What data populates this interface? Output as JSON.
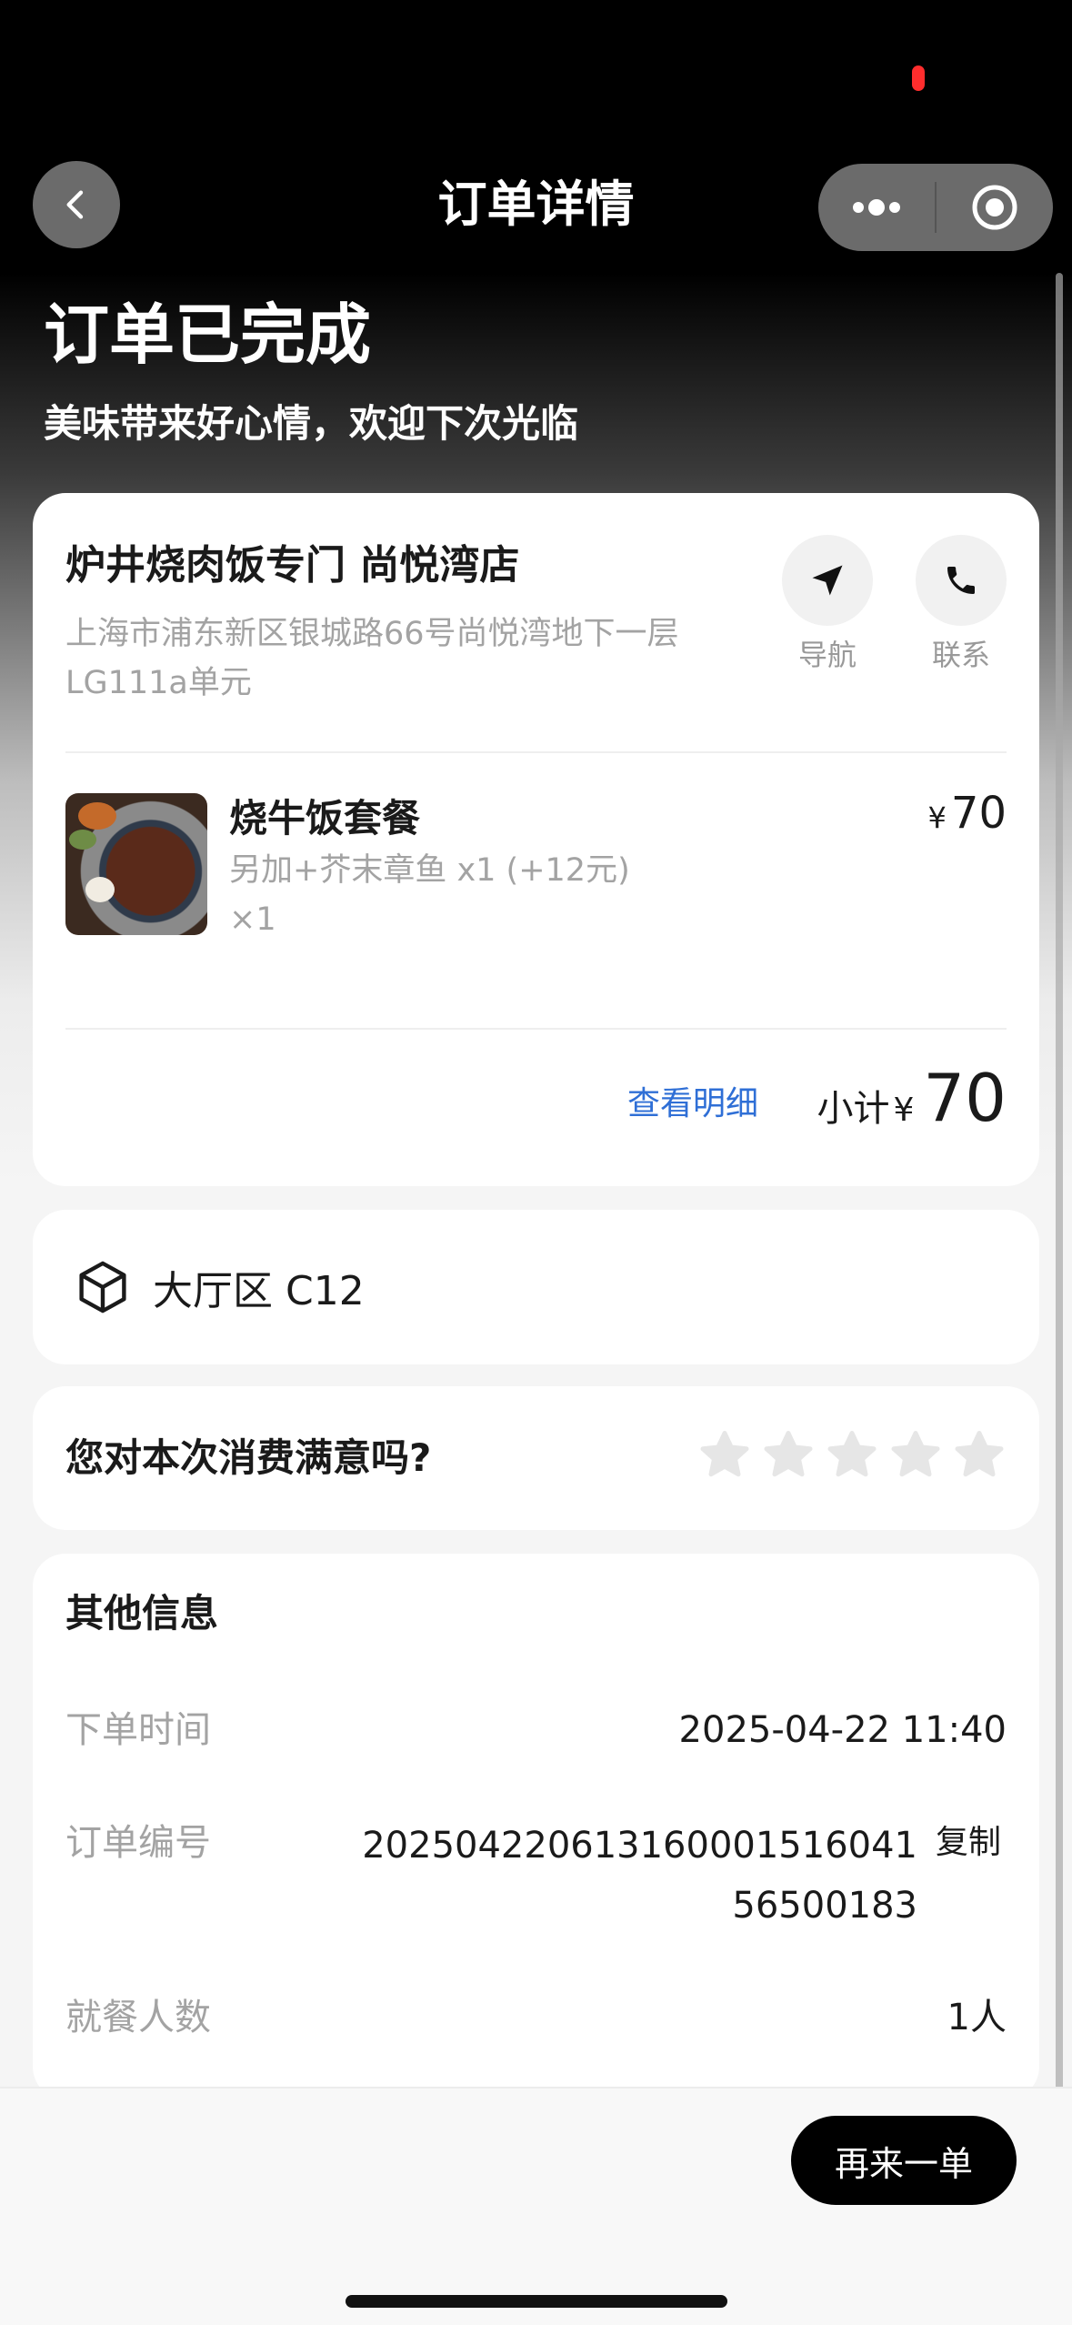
{
  "nav": {
    "title": "订单详情"
  },
  "status": {
    "title": "订单已完成",
    "subtitle": "美味带来好心情，欢迎下次光临"
  },
  "store": {
    "name": "炉井烧肉饭专门 尚悦湾店",
    "address": "上海市浦东新区银城路66号尚悦湾地下一层LG111a单元",
    "actions": {
      "navigate_label": "导航",
      "contact_label": "联系"
    }
  },
  "item": {
    "name": "烧牛饭套餐",
    "option": "另加+芥末章鱼 x1 (+12元)",
    "quantity": "×1",
    "currency": "¥",
    "price": "70"
  },
  "summary": {
    "detail_link": "查看明细",
    "subtotal_label": "小计",
    "currency": "¥",
    "subtotal": "70"
  },
  "table": {
    "label": "大厅区 C12"
  },
  "rating": {
    "question": "您对本次消费满意吗?",
    "stars_selected": 0,
    "stars_total": 5
  },
  "other_info": {
    "title": "其他信息",
    "order_time_label": "下单时间",
    "order_time": "2025-04-22 11:40",
    "order_no_label": "订单编号",
    "order_no": "20250422061316000151604156500183",
    "copy_label": "复制",
    "diners_label": "就餐人数",
    "diners": "1人"
  },
  "footer": {
    "reorder_label": "再来一单"
  },
  "colors": {
    "accent_link": "#2f6fd6",
    "star_empty": "#e6e6e6",
    "recording": "#ff2d2d"
  }
}
